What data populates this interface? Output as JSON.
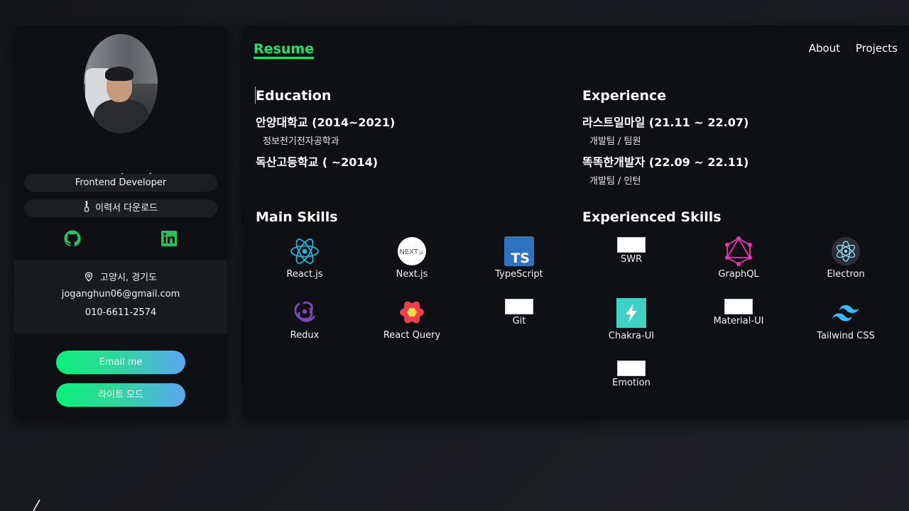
{
  "sidebar": {
    "name": "조 강 훈",
    "role": "Frontend Developer",
    "resume_download": "이력서 다운로드",
    "resume_download_icon": "zipper-icon",
    "social": [
      {
        "name": "github-icon"
      },
      {
        "name": "linkedin-icon"
      }
    ],
    "location": "고양시, 경기도",
    "email": "joganghun06@gmail.com",
    "phone": "010-6611-2574",
    "email_button": "Email me",
    "theme_button": "라이트 모드"
  },
  "header": {
    "logo": "Resume",
    "nav": [
      "About",
      "Projects"
    ]
  },
  "education": {
    "title": "Education",
    "items": [
      {
        "school": "안양대학교 (2014~2021)",
        "detail": "정보전기전자공학과"
      },
      {
        "school": "독산고등학교 ( ~2014)",
        "detail": ""
      }
    ]
  },
  "experience": {
    "title": "Experience",
    "items": [
      {
        "company": "라스트일마일 (21.11 ~ 22.07)",
        "detail": "개발팀 / 팀원"
      },
      {
        "company": "똑똑한개발자 (22.09 ~ 22.11)",
        "detail": "개발팀 / 인턴"
      }
    ]
  },
  "main_skills": {
    "title": "Main Skills",
    "items": [
      {
        "label": "React.js",
        "icon": "react-icon"
      },
      {
        "label": "Next.js",
        "icon": "nextjs-icon"
      },
      {
        "label": "TypeScript",
        "icon": "typescript-icon"
      },
      {
        "label": "Redux",
        "icon": "redux-icon"
      },
      {
        "label": "React Query",
        "icon": "react-query-icon"
      },
      {
        "label": "Git",
        "icon": "broken-image-icon"
      }
    ]
  },
  "experienced_skills": {
    "title": "Experienced Skills",
    "items": [
      {
        "label": "SWR",
        "icon": "broken-image-icon"
      },
      {
        "label": "GraphQL",
        "icon": "graphql-icon"
      },
      {
        "label": "Electron",
        "icon": "electron-icon"
      },
      {
        "label": "Chakra-UI",
        "icon": "chakra-icon"
      },
      {
        "label": "Material-UI",
        "icon": "broken-image-icon"
      },
      {
        "label": "Tailwind CSS",
        "icon": "tailwind-icon"
      },
      {
        "label": "Emotion",
        "icon": "broken-image-icon"
      }
    ]
  },
  "colors": {
    "accent": "#1ee26b",
    "background": "#0f1013",
    "gradient_start": "#0bf07a",
    "gradient_end": "#5aa7f0"
  }
}
